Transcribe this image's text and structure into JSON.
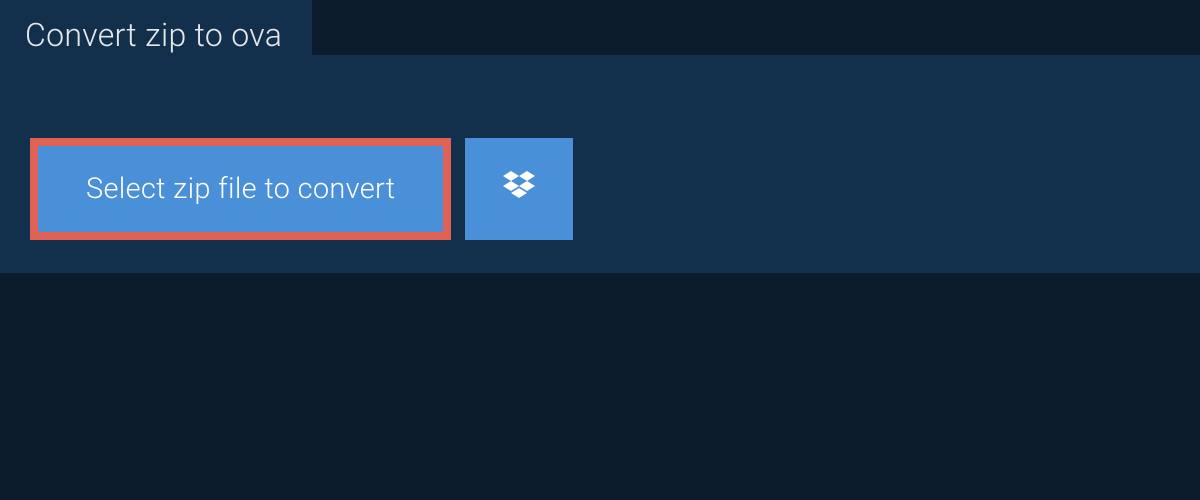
{
  "header": {
    "title": "Convert zip to ova"
  },
  "actions": {
    "select_label": "Select zip file to convert"
  },
  "colors": {
    "page_bg": "#0b1b2b",
    "panel_bg": "#12304b",
    "button_bg": "#4a90d9",
    "button_border": "#e06257",
    "text_light": "#e6e9ec",
    "text_white": "#ffffff"
  },
  "icons": {
    "dropbox": "dropbox-icon"
  }
}
